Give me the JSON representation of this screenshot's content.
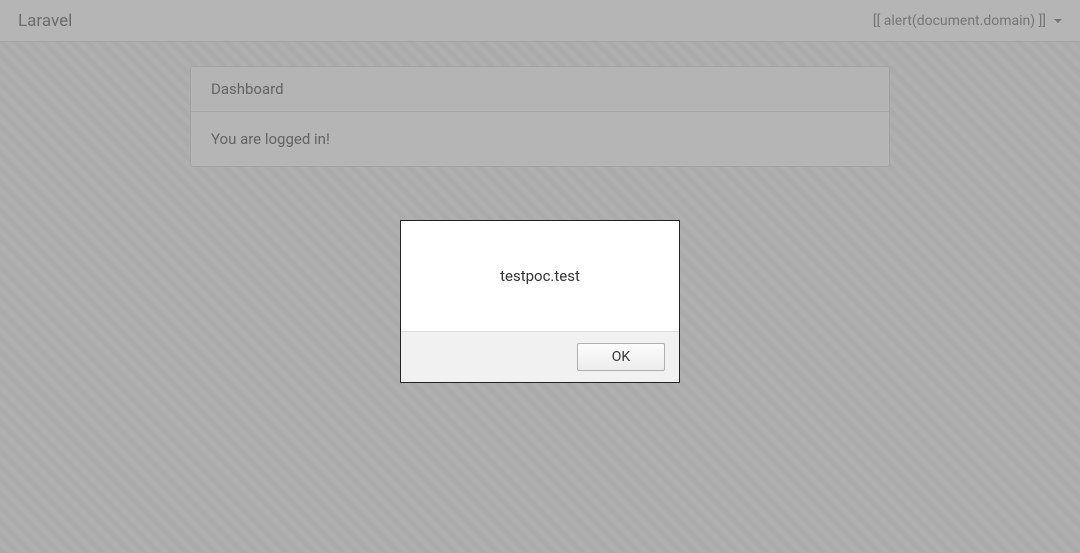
{
  "navbar": {
    "brand": "Laravel",
    "user_label": "[[ alert(document.domain) ]]"
  },
  "card": {
    "header": "Dashboard",
    "body": "You are logged in!"
  },
  "alert": {
    "message": "testpoc.test",
    "ok_label": "OK"
  }
}
